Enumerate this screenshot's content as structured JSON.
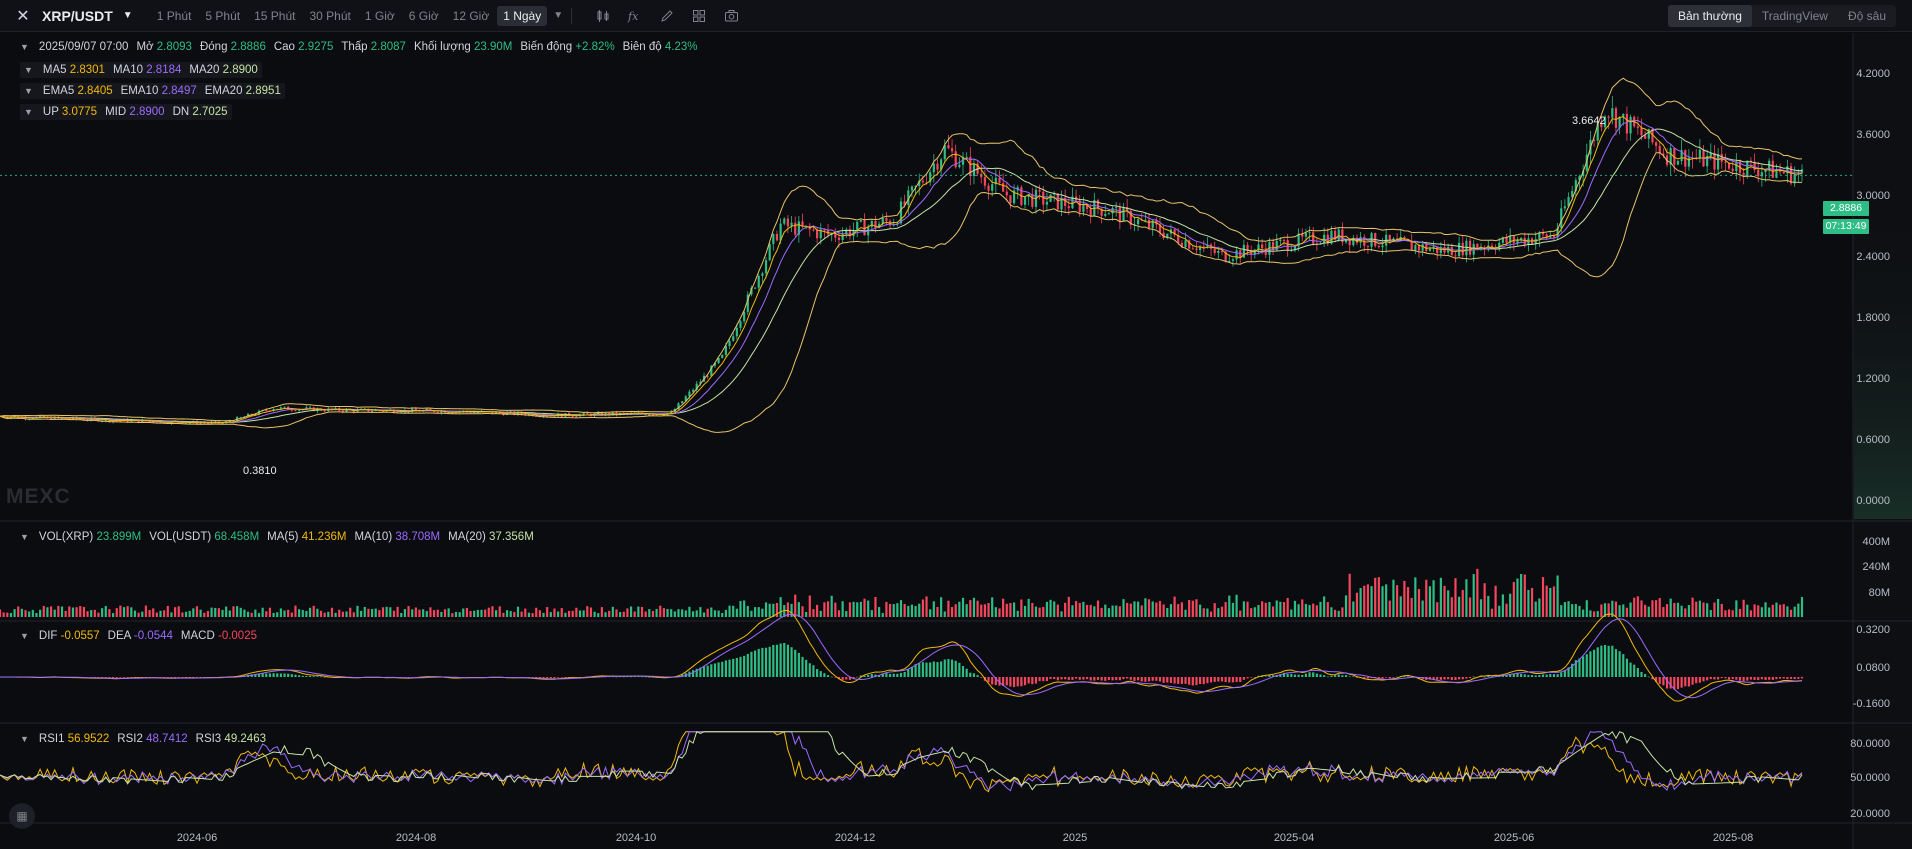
{
  "toolbar": {
    "logo": "✕",
    "pair": "XRP/USDT",
    "intervals": [
      "1 Phút",
      "5 Phút",
      "15 Phút",
      "30 Phút",
      "1 Giờ",
      "6 Giờ",
      "12 Giờ",
      "1 Ngày"
    ],
    "active_interval": "1 Ngày",
    "icons": [
      "candle-type-icon",
      "indicator-fx-icon",
      "draw-pencil-icon",
      "layout-grid-icon",
      "camera-icon"
    ],
    "view_tabs": [
      "Bản thường",
      "TradingView",
      "Độ sâu"
    ],
    "active_view": "Bản thường"
  },
  "ohlc": {
    "date": "2025/09/07 07:00",
    "open_label": "Mở",
    "open": "2.8093",
    "close_label": "Đóng",
    "close": "2.8886",
    "high_label": "Cao",
    "high": "2.9275",
    "low_label": "Thấp",
    "low": "2.8087",
    "volume_label": "Khối lượng",
    "volume": "23.90M",
    "change_label": "Biến động",
    "change": "+2.82%",
    "amplitude_label": "Biên độ",
    "amplitude": "4.23%"
  },
  "ma": {
    "ma5_label": "MA5",
    "ma5": "2.8301",
    "ma10_label": "MA10",
    "ma10": "2.8184",
    "ma20_label": "MA20",
    "ma20": "2.8900"
  },
  "ema": {
    "ema5_label": "EMA5",
    "ema5": "2.8405",
    "ema10_label": "EMA10",
    "ema10": "2.8497",
    "ema20_label": "EMA20",
    "ema20": "2.8951"
  },
  "boll": {
    "up_label": "UP",
    "up": "3.0775",
    "mid_label": "MID",
    "mid": "2.8900",
    "dn_label": "DN",
    "dn": "2.7025"
  },
  "volume": {
    "vol_xrp_label": "VOL(XRP)",
    "vol_xrp": "23.899M",
    "vol_usdt_label": "VOL(USDT)",
    "vol_usdt": "68.458M",
    "ma5_label": "MA(5)",
    "ma5": "41.236M",
    "ma10_label": "MA(10)",
    "ma10": "38.708M",
    "ma20_label": "MA(20)",
    "ma20": "37.356M",
    "axis": [
      "400M",
      "240M",
      "80M"
    ]
  },
  "macd": {
    "dif_label": "DIF",
    "dif": "-0.0557",
    "dea_label": "DEA",
    "dea": "-0.0544",
    "macd_label": "MACD",
    "macd": "-0.0025",
    "axis": [
      "0.3200",
      "0.0800",
      "-0.1600"
    ]
  },
  "rsi": {
    "rsi1_label": "RSI1",
    "rsi1": "56.9522",
    "rsi2_label": "RSI2",
    "rsi2": "48.7412",
    "rsi3_label": "RSI3",
    "rsi3": "49.2463",
    "axis": [
      "80.0000",
      "50.0000",
      "20.0000"
    ]
  },
  "price_axis": [
    "4.2000",
    "3.6000",
    "3.0000",
    "2.4000",
    "1.8000",
    "1.2000",
    "0.6000",
    "0.0000"
  ],
  "last_price": "2.8886",
  "countdown": "07:13:49",
  "high_marker": "3.6642",
  "low_marker": "0.3810",
  "watermark": "MEXC",
  "x_axis": [
    "2024-06",
    "2024-08",
    "2024-10",
    "2024-12",
    "2025",
    "2025-04",
    "2025-06",
    "2025-08"
  ],
  "colors": {
    "up": "#2ebd85",
    "down": "#f6465d",
    "ma5": "#f0b90b",
    "ma10": "#9b6bff",
    "ma20": "#c5e3a5",
    "boll": "#e8c36a",
    "bg": "#0b0c0f"
  },
  "chart_data": {
    "type": "line",
    "x": [
      "2024-05-01",
      "2024-06-01",
      "2024-07-01",
      "2024-07-15",
      "2024-08-01",
      "2024-09-01",
      "2024-10-01",
      "2024-11-01",
      "2024-11-15",
      "2024-12-01",
      "2024-12-15",
      "2025-01-01",
      "2025-01-15",
      "2025-02-01",
      "2025-03-01",
      "2025-04-01",
      "2025-05-01",
      "2025-06-01",
      "2025-07-01",
      "2025-07-15",
      "2025-08-01",
      "2025-09-07"
    ],
    "series": [
      {
        "name": "XRP/USDT",
        "values": [
          0.52,
          0.48,
          0.45,
          0.6,
          0.58,
          0.57,
          0.53,
          0.55,
          1.1,
          2.4,
          2.3,
          2.45,
          3.15,
          2.7,
          2.55,
          2.1,
          2.3,
          2.15,
          2.3,
          3.55,
          3.1,
          2.8886
        ]
      }
    ],
    "ylim": [
      0,
      4.4
    ]
  }
}
